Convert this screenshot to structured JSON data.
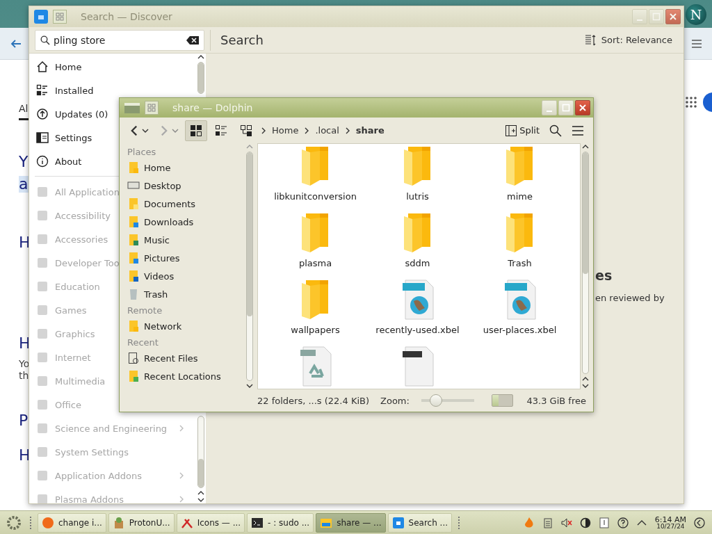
{
  "desktop": {
    "corner_logo": "N"
  },
  "browser": {
    "tab_label": "Al",
    "fragments": [
      {
        "text": "Y",
        "kind": "heading"
      },
      {
        "text": "a",
        "kind": "highlight"
      },
      {
        "text": "H",
        "kind": "heading"
      },
      {
        "text": "H",
        "kind": "heading"
      },
      {
        "text": "Yo",
        "kind": "body"
      },
      {
        "text": "th",
        "kind": "body"
      },
      {
        "text": "P",
        "kind": "heading"
      },
      {
        "text": "H",
        "kind": "heading"
      }
    ]
  },
  "discover": {
    "title": "Search — Discover",
    "search": {
      "value": "pling store"
    },
    "page_title": "Search",
    "sort": "Sort: Relevance",
    "nav": [
      {
        "label": "Home"
      },
      {
        "label": "Installed"
      },
      {
        "label": "Updates (0)"
      },
      {
        "label": "Settings"
      },
      {
        "label": "About"
      }
    ],
    "categories": [
      {
        "label": "All Application",
        "has_submenu": false
      },
      {
        "label": "Accessibility",
        "has_submenu": false
      },
      {
        "label": "Accessories",
        "has_submenu": false
      },
      {
        "label": "Developer Too",
        "has_submenu": false
      },
      {
        "label": "Education",
        "has_submenu": false
      },
      {
        "label": "Games",
        "has_submenu": false
      },
      {
        "label": "Graphics",
        "has_submenu": false
      },
      {
        "label": "Internet",
        "has_submenu": false
      },
      {
        "label": "Multimedia",
        "has_submenu": false
      },
      {
        "label": "Office",
        "has_submenu": false
      },
      {
        "label": "Science and Engineering",
        "has_submenu": true
      },
      {
        "label": "System Settings",
        "has_submenu": false
      },
      {
        "label": "Application Addons",
        "has_submenu": true
      },
      {
        "label": "Plasma Addons",
        "has_submenu": true
      }
    ],
    "content_fragments": [
      {
        "text": "es",
        "kind": "heading"
      },
      {
        "text": "en reviewed by",
        "kind": "body"
      }
    ]
  },
  "dolphin": {
    "title": "share — Dolphin",
    "view_modes": [
      {
        "kind": "icons",
        "selected": true
      },
      {
        "kind": "details",
        "selected": false
      },
      {
        "kind": "tree",
        "selected": false
      }
    ],
    "breadcrumb": [
      {
        "label": "Home",
        "current": false
      },
      {
        "label": ".local",
        "current": false
      },
      {
        "label": "share",
        "current": true
      }
    ],
    "split_label": "Split",
    "places": [
      {
        "heading": "Places",
        "items": [
          {
            "label": "Home"
          },
          {
            "label": "Desktop"
          },
          {
            "label": "Documents"
          },
          {
            "label": "Downloads"
          },
          {
            "label": "Music"
          },
          {
            "label": "Pictures"
          },
          {
            "label": "Videos"
          },
          {
            "label": "Trash"
          }
        ]
      },
      {
        "heading": "Remote",
        "items": [
          {
            "label": "Network"
          }
        ]
      },
      {
        "heading": "Recent",
        "items": [
          {
            "label": "Recent Files"
          },
          {
            "label": "Recent Locations"
          }
        ]
      }
    ],
    "files": [
      {
        "name": "libkunitconversion",
        "kind": "folder"
      },
      {
        "name": "lutris",
        "kind": "folder"
      },
      {
        "name": "mime",
        "kind": "folder"
      },
      {
        "name": "plasma",
        "kind": "folder"
      },
      {
        "name": "sddm",
        "kind": "folder"
      },
      {
        "name": "Trash",
        "kind": "folder"
      },
      {
        "name": "wallpapers",
        "kind": "folder"
      },
      {
        "name": "recently-used.xbel",
        "kind": "html"
      },
      {
        "name": "user-places.xbel",
        "kind": "html"
      },
      {
        "kind": "recycle"
      },
      {
        "kind": "file"
      }
    ],
    "status": {
      "summary": "22 folders, ...s (22.4 KiB)",
      "zoom_label": "Zoom:",
      "zoom": {
        "level": 0.28
      },
      "space": {
        "level": 0.3
      },
      "free": "43.3 GiB free"
    }
  },
  "taskbar": {
    "tasks": [
      {
        "label": "change i...",
        "kind": "browser",
        "selected": false
      },
      {
        "label": "ProtonU...",
        "kind": "package",
        "selected": false
      },
      {
        "label": "Icons — ...",
        "kind": "tools",
        "selected": false
      },
      {
        "label": "- : sudo ...",
        "kind": "terminal",
        "selected": false
      },
      {
        "label": "share — ...",
        "kind": "folder",
        "selected": true
      },
      {
        "label": "Search ...",
        "kind": "store",
        "selected": false
      }
    ],
    "time": "6:14 AM",
    "date": "10/27/24"
  }
}
